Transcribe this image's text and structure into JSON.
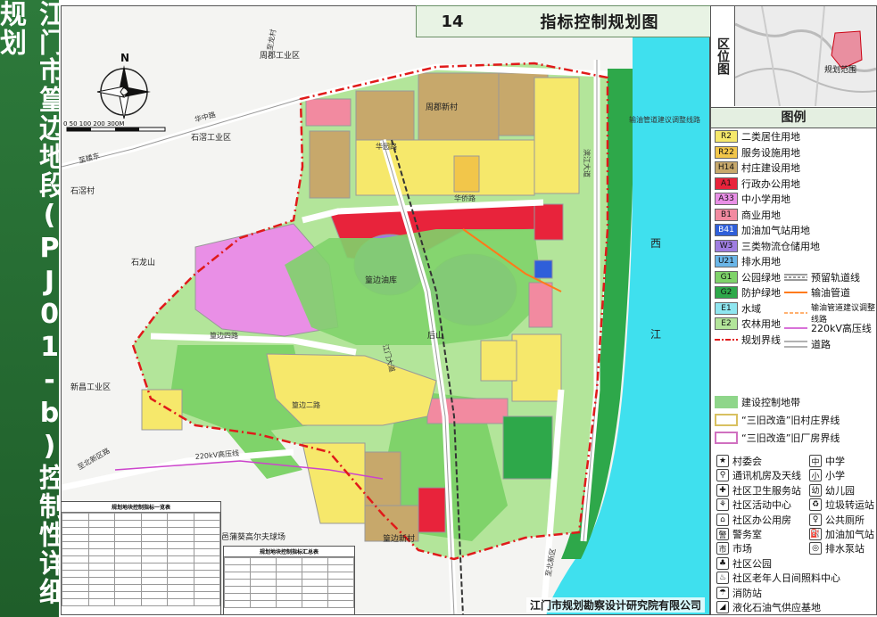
{
  "sidebar": {
    "title": "江门市篁边地段(PJ01-b)控制性详细规划"
  },
  "header": {
    "number": "14",
    "title": "指标控制规划图"
  },
  "inset": {
    "label": "区位图",
    "range_label": "规划范围"
  },
  "legend": {
    "title": "图例",
    "landuse": [
      {
        "code": "R2",
        "label": "二类居住用地",
        "color": "#f6e86b"
      },
      {
        "code": "R22",
        "label": "服务设施用地",
        "color": "#f2c64a"
      },
      {
        "code": "H14",
        "label": "村庄建设用地",
        "color": "#c7a86b"
      },
      {
        "code": "A1",
        "label": "行政办公用地",
        "color": "#e8233b"
      },
      {
        "code": "A33",
        "label": "中小学用地",
        "color": "#e98fe6"
      },
      {
        "code": "B1",
        "label": "商业用地",
        "color": "#f28aa0"
      },
      {
        "code": "B41",
        "label": "加油加气站用地",
        "color": "#2f5fd9"
      },
      {
        "code": "W3",
        "label": "三类物流仓储用地",
        "color": "#9f7de0"
      },
      {
        "code": "U21",
        "label": "排水用地",
        "color": "#6ab6e8"
      },
      {
        "code": "G1",
        "label": "公园绿地",
        "color": "#7fd36a"
      },
      {
        "code": "G2",
        "label": "防护绿地",
        "color": "#2ea84a"
      },
      {
        "code": "E1",
        "label": "水域",
        "color": "#8fe6f0"
      },
      {
        "code": "E2",
        "label": "农林用地",
        "color": "#b3e59a"
      }
    ],
    "lines": [
      {
        "label": "预留轨道线"
      },
      {
        "label": "输油管道"
      },
      {
        "label": "输油管道建议调整线路"
      },
      {
        "label": "220kV高压线"
      },
      {
        "label": "道路"
      }
    ],
    "boundary": "规划界线",
    "zones": [
      {
        "label": "建设控制地带"
      },
      {
        "label": "“三旧改造”旧村庄界线"
      },
      {
        "label": "“三旧改造”旧厂房界线"
      }
    ],
    "symbols": [
      {
        "icon": "★",
        "label": "村委会"
      },
      {
        "icon": "中",
        "label": "中学"
      },
      {
        "icon": "⚲",
        "label": "通讯机房及天线"
      },
      {
        "icon": "小",
        "label": "小学"
      },
      {
        "icon": "✚",
        "label": "社区卫生服务站"
      },
      {
        "icon": "幼",
        "label": "幼儿园"
      },
      {
        "icon": "⚘",
        "label": "社区活动中心"
      },
      {
        "icon": "♻",
        "label": "垃圾转运站"
      },
      {
        "icon": "⌂",
        "label": "社区办公用房"
      },
      {
        "icon": "♀",
        "label": "公共厕所"
      },
      {
        "icon": "警",
        "label": "警务室"
      },
      {
        "icon": "⛽",
        "label": "加油加气站"
      },
      {
        "icon": "市",
        "label": "市场"
      },
      {
        "icon": "◎",
        "label": "排水泵站"
      },
      {
        "icon": "♣",
        "label": "社区公园"
      },
      {
        "icon": "♨",
        "label": "社区老年人日间照料中心"
      },
      {
        "icon": "☂",
        "label": "消防站"
      },
      {
        "icon": "◢",
        "label": "液化石油气供应基地"
      }
    ]
  },
  "map": {
    "place_labels": [
      "周郡工业区",
      "石滘工业区",
      "石滘村",
      "石龙山",
      "新昌工业区",
      "五邑蒲葵高尔夫球场",
      "后山",
      "篁边油库",
      "篁边新村",
      "周郡新村",
      "西",
      "江"
    ],
    "road_labels": [
      "华中路",
      "华侨路",
      "至龙村",
      "江门大道",
      "滨江大道",
      "篁边四路",
      "篁边二路",
      "华园路",
      "至北新区",
      "至北新区路",
      "至楼东",
      "输油管道建议调整线路"
    ],
    "line_label_220": "220kV高压线",
    "scale_label": "0   50  100     200       300M",
    "north": "N"
  },
  "company": "江门市规划勘察设计研究院有限公司",
  "table1": {
    "title": "规划地块控制指标一览表"
  },
  "table2": {
    "title": "规划地块控制指标汇总表"
  }
}
